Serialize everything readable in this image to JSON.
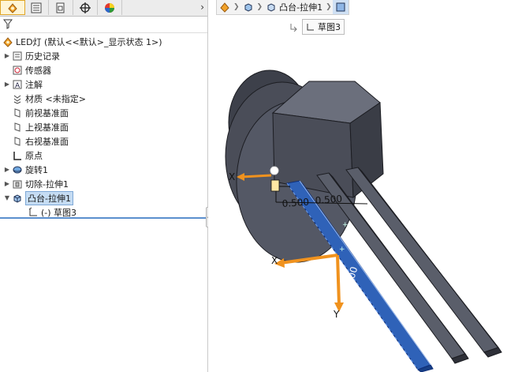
{
  "tabs": [
    {
      "icon": "feature-manager-icon",
      "active": true
    },
    {
      "icon": "property-manager-icon",
      "active": false
    },
    {
      "icon": "configuration-manager-icon",
      "active": false
    },
    {
      "icon": "dimxpert-icon",
      "active": false
    },
    {
      "icon": "display-manager-icon",
      "active": false
    }
  ],
  "tree": {
    "root_label": "LED灯 (默认<<默认>_显示状态 1>)",
    "items": [
      {
        "label": "历史记录",
        "icon": "history-icon",
        "expandable": true
      },
      {
        "label": "传感器",
        "icon": "sensor-icon",
        "expandable": false
      },
      {
        "label": "注解",
        "icon": "annotation-icon",
        "expandable": true
      },
      {
        "label": "材质 <未指定>",
        "icon": "material-icon",
        "expandable": false
      },
      {
        "label": "前视基准面",
        "icon": "plane-icon",
        "expandable": false
      },
      {
        "label": "上视基准面",
        "icon": "plane-icon",
        "expandable": false
      },
      {
        "label": "右视基准面",
        "icon": "plane-icon",
        "expandable": false
      },
      {
        "label": "原点",
        "icon": "origin-icon",
        "expandable": false
      },
      {
        "label": "旋转1",
        "icon": "revolve-icon",
        "expandable": true
      },
      {
        "label": "切除-拉伸1",
        "icon": "cut-extrude-icon",
        "expandable": true
      },
      {
        "label": "凸台-拉伸1",
        "icon": "boss-extrude-icon",
        "expandable": true,
        "expanded": true,
        "selected": true
      },
      {
        "label": "(-) 草图3",
        "icon": "sketch-icon",
        "expandable": false,
        "child": true
      }
    ]
  },
  "breadcrumb": {
    "items": [
      {
        "icon": "part-icon",
        "label": ""
      },
      {
        "icon": "body-icon",
        "label": ""
      },
      {
        "icon": "feature-icon",
        "label": "凸台-拉伸1"
      },
      {
        "icon": "face-icon",
        "label": ""
      }
    ],
    "sketch_label": "草图3"
  },
  "dimensions": {
    "d1": "0.500",
    "d2": "0.500",
    "d3": "0.500"
  },
  "axes": {
    "x": "X",
    "y": "Y"
  },
  "colors": {
    "body": "#4a4d58",
    "body_dark": "#2e3038",
    "body_light": "#6b6f7c",
    "selected_face": "#2f62b8",
    "triad": "#f0921e"
  }
}
